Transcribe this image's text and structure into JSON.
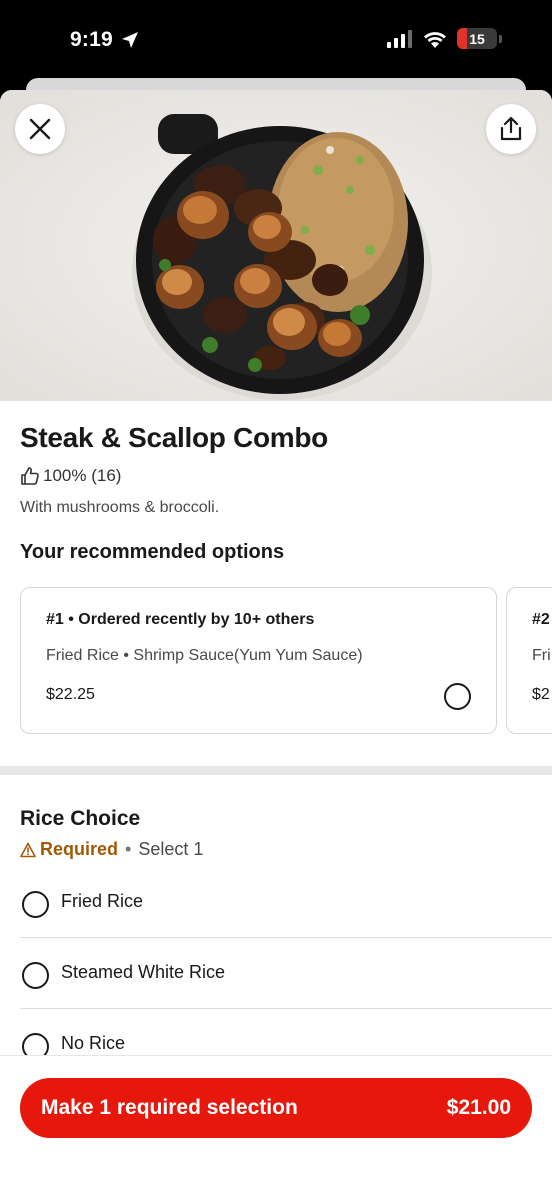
{
  "status_bar": {
    "time": "9:19",
    "battery": "15"
  },
  "item": {
    "title": "Steak & Scallop Combo",
    "rating": "100% (16)",
    "description": "With mushrooms & broccoli."
  },
  "recommended": {
    "title": "Your recommended options",
    "cards": [
      {
        "heading": "#1 • Ordered recently by 10+ others",
        "items": "Fried Rice • Shrimp Sauce(Yum Yum Sauce)",
        "price": "$22.25"
      },
      {
        "heading": "#2",
        "items": "Fri",
        "price": "$2"
      }
    ]
  },
  "rice_choice": {
    "title": "Rice Choice",
    "required_label": "Required",
    "dot": "•",
    "select_text": "Select 1",
    "options": [
      {
        "label": "Fried Rice"
      },
      {
        "label": "Steamed White Rice"
      },
      {
        "label": "No Rice"
      }
    ]
  },
  "footer": {
    "cta_label": "Make 1 required selection",
    "cta_price": "$21.00"
  },
  "colors": {
    "cta_red": "#e6180c",
    "required_orange": "#a05a06",
    "text_dark": "#191919"
  }
}
